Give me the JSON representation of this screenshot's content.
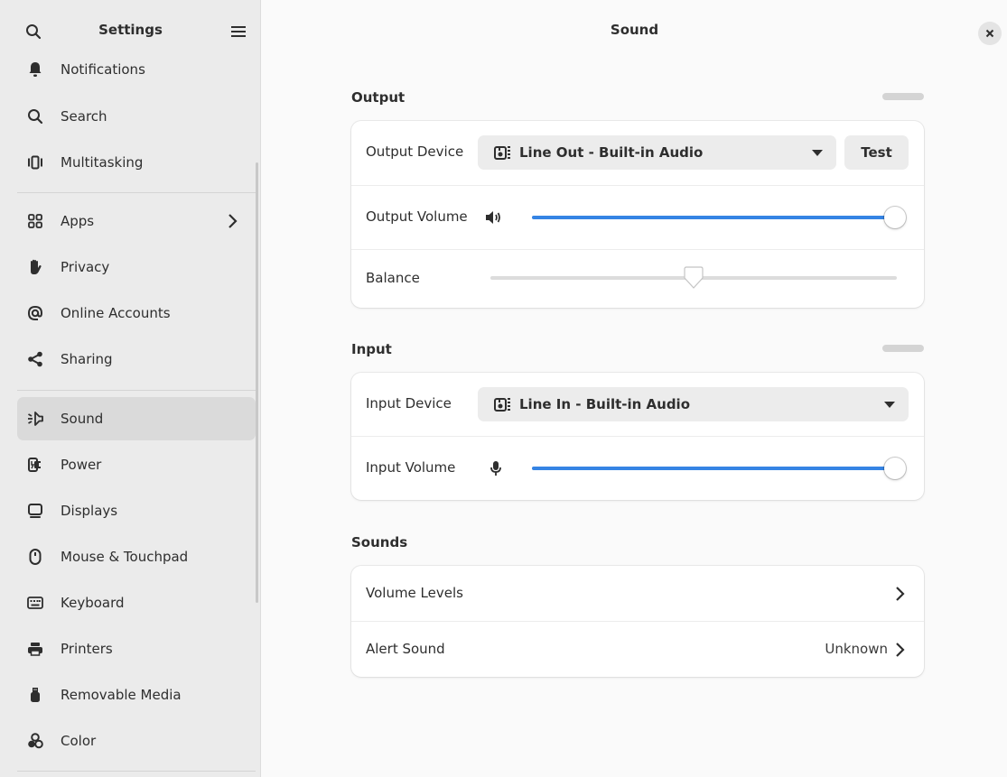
{
  "sidebar": {
    "title": "Settings",
    "items": [
      {
        "label": "Notifications",
        "icon": "bell-icon"
      },
      {
        "label": "Search",
        "icon": "search-icon"
      },
      {
        "label": "Multitasking",
        "icon": "multitasking-icon"
      },
      {
        "label": "Apps",
        "icon": "apps-grid-icon"
      },
      {
        "label": "Privacy",
        "icon": "hand-icon"
      },
      {
        "label": "Online Accounts",
        "icon": "at-sign-icon"
      },
      {
        "label": "Sharing",
        "icon": "share-icon"
      },
      {
        "label": "Sound",
        "icon": "speaker-icon"
      },
      {
        "label": "Power",
        "icon": "power-plug-icon"
      },
      {
        "label": "Displays",
        "icon": "monitor-icon"
      },
      {
        "label": "Mouse & Touchpad",
        "icon": "mouse-icon"
      },
      {
        "label": "Keyboard",
        "icon": "keyboard-icon"
      },
      {
        "label": "Printers",
        "icon": "printer-icon"
      },
      {
        "label": "Removable Media",
        "icon": "usb-icon"
      },
      {
        "label": "Color",
        "icon": "color-icon"
      }
    ],
    "active": "Sound"
  },
  "main": {
    "title": "Sound",
    "output": {
      "title": "Output",
      "device_label": "Output Device",
      "device_value": "Line Out - Built-in Audio",
      "test_label": "Test",
      "volume_label": "Output Volume",
      "volume_fraction": 1.0,
      "balance_label": "Balance",
      "balance_fraction": 0.5
    },
    "input": {
      "title": "Input",
      "device_label": "Input Device",
      "device_value": "Line In - Built-in Audio",
      "volume_label": "Input Volume",
      "volume_fraction": 1.0
    },
    "sounds": {
      "title": "Sounds",
      "volume_levels_label": "Volume Levels",
      "alert_sound_label": "Alert Sound",
      "alert_sound_value": "Unknown"
    }
  },
  "colors": {
    "accent": "#3584e4",
    "sidebar_bg": "#ebebeb",
    "active_item_bg": "#dadada"
  }
}
